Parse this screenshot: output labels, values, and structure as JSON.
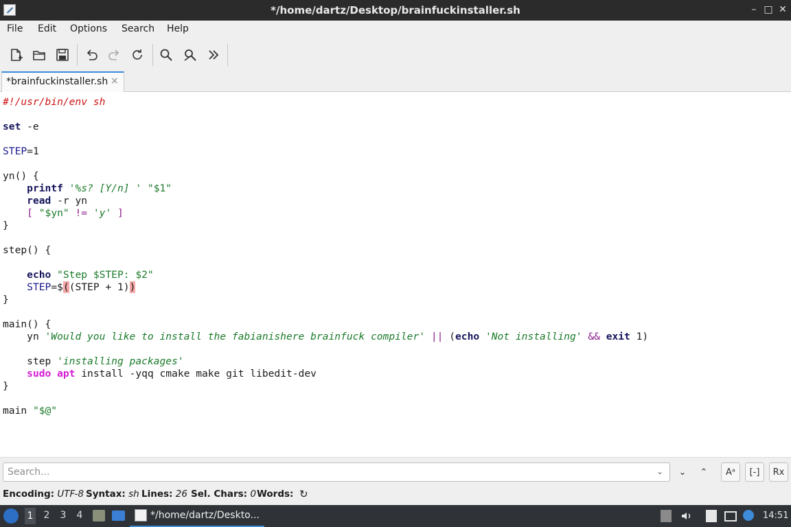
{
  "window": {
    "title": "*/home/dartz/Desktop/brainfuckinstaller.sh",
    "minimize_glyph": "–",
    "maximize_glyph": "□",
    "close_glyph": "✕"
  },
  "menu": {
    "file": "File",
    "edit": "Edit",
    "options": "Options",
    "search": "Search",
    "help": "Help"
  },
  "toolbar": {
    "icons": [
      "new-document-icon",
      "open-folder-icon",
      "save-icon",
      "undo-icon",
      "redo-icon",
      "reload-icon",
      "find-icon",
      "replace-icon",
      "more-icon"
    ]
  },
  "tab": {
    "label": "*brainfuckinstaller.sh",
    "close_glyph": "×"
  },
  "code": {
    "l1": "#!/usr/bin/env sh",
    "l3_kw": "set",
    "l3_rest": " -e",
    "l5_var": "STEP",
    "l5_rest": "=1",
    "l7": "yn() {",
    "l8_indent": "    ",
    "l8_kw": "printf",
    "l8_sp": " ",
    "l8_s1": "'%s? [Y/n] '",
    "l8_sp2": " ",
    "l8_s2": "\"$1\"",
    "l9_indent": "    ",
    "l9_kw": "read",
    "l9_rest": " -r yn",
    "l10_indent": "    ",
    "l10_b1": "[",
    "l10_sp": " ",
    "l10_s1": "\"$yn\"",
    "l10_op": " != ",
    "l10_s2": "'y'",
    "l10_b2": " ]",
    "l11": "}",
    "l13": "step() {",
    "l15_indent": "    ",
    "l15_kw": "echo",
    "l15_sp": " ",
    "l15_s": "\"Step $STEP: $2\"",
    "l16_indent": "    ",
    "l16_var": "STEP",
    "l16_eq": "=$",
    "l16_p1": "(",
    "l16_mid": "(STEP + 1)",
    "l16_p2": ")",
    "l17": "}",
    "l19": "main() {",
    "l20_indent": "    ",
    "l20_cmd": "yn ",
    "l20_s1": "'Would you like to install the fabianishere brainfuck compiler'",
    "l20_op1": " || ",
    "l20_paren": "(",
    "l20_kw1": "echo",
    "l20_sp": " ",
    "l20_s2": "'Not installing'",
    "l20_op2": " && ",
    "l20_kw2": "exit",
    "l20_end": " 1)",
    "l22_indent": "    ",
    "l22_cmd": "step ",
    "l22_s": "'installing packages'",
    "l23_indent": "    ",
    "l23_sudo": "sudo",
    "l23_sp": " ",
    "l23_apt": "apt",
    "l23_rest": " install -yqq cmake make git libedit-dev",
    "l24": "}",
    "l26_cmd": "main ",
    "l26_s": "\"$@\""
  },
  "search": {
    "placeholder": "Search...",
    "dropdown_glyph": "⌄",
    "next_glyph": "⌄",
    "prev_glyph": "⌃",
    "match_case_glyph": "Aᵃ",
    "whole_word_glyph": "[-]",
    "regex_glyph": "Rx"
  },
  "status": {
    "encoding_label": "Encoding:",
    "encoding_value": "UTF-8",
    "syntax_label": "Syntax:",
    "syntax_value": "sh",
    "lines_label": "Lines:",
    "lines_value": "26",
    "sel_label": "Sel. Chars:",
    "sel_value": "0",
    "words_label": "Words:",
    "refresh_glyph": "↻"
  },
  "taskbar": {
    "workspaces": [
      "1",
      "2",
      "3",
      "4"
    ],
    "task_label": "*/home/dartz/Deskto...",
    "clock": "14:51"
  },
  "colors": {
    "comment": "#cc1111",
    "keyword": "#14145c",
    "string": "#1b7a2a",
    "operator": "#8b1c8b",
    "sudo": "#d41ad4",
    "accent": "#3d8bd9"
  }
}
